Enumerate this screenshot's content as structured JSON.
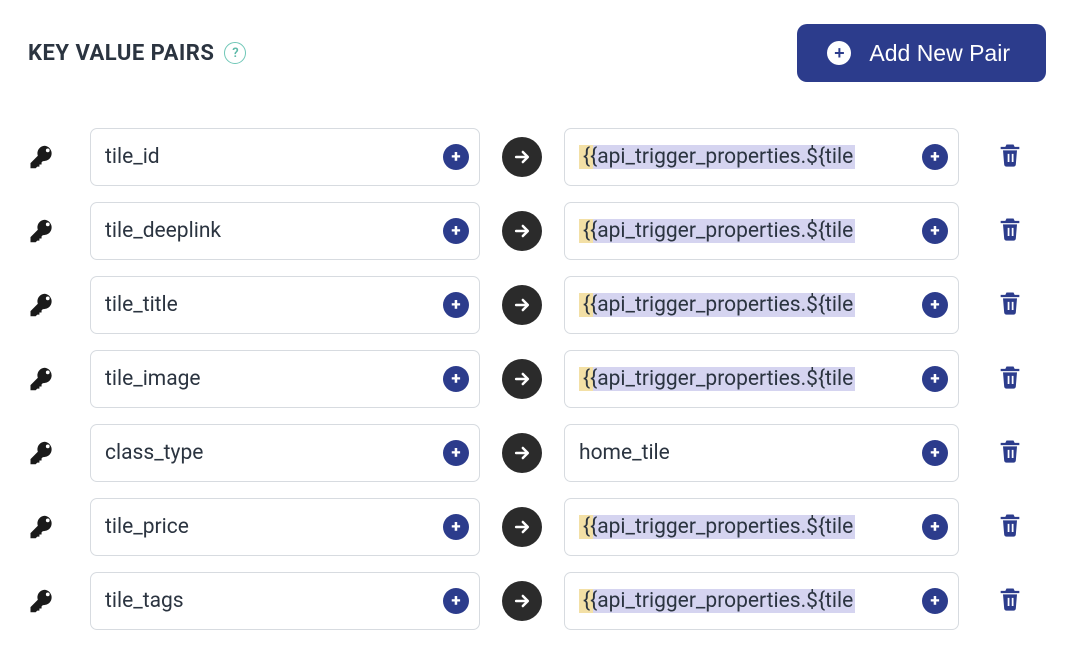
{
  "header": {
    "title": "KEY VALUE PAIRS",
    "help_symbol": "?",
    "add_button_label": "Add New Pair"
  },
  "pairs": [
    {
      "key": "tile_id",
      "value": "{{api_trigger_properties.${tile",
      "value_highlighted": true
    },
    {
      "key": "tile_deeplink",
      "value": "{{api_trigger_properties.${tile",
      "value_highlighted": true
    },
    {
      "key": "tile_title",
      "value": "{{api_trigger_properties.${tile",
      "value_highlighted": true
    },
    {
      "key": "tile_image",
      "value": "{{api_trigger_properties.${tile",
      "value_highlighted": true
    },
    {
      "key": "class_type",
      "value": "home_tile",
      "value_highlighted": false
    },
    {
      "key": "tile_price",
      "value": "{{api_trigger_properties.${tile",
      "value_highlighted": true
    },
    {
      "key": "tile_tags",
      "value": "{{api_trigger_properties.${tile",
      "value_highlighted": true
    }
  ]
}
